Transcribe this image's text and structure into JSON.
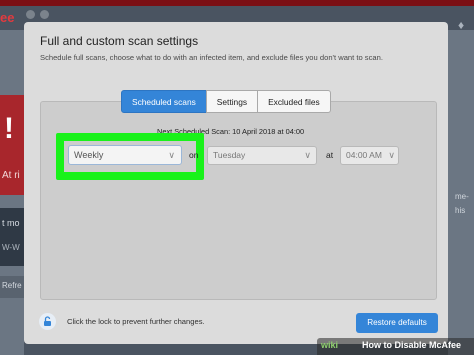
{
  "background_app": {
    "logo": "ee",
    "alert_text": "At ri",
    "side_text_1": "t mo",
    "side_text_2": "W-W",
    "side_text_3": "Refre",
    "right_text_1": "me-",
    "right_text_2": "his",
    "bell_icon": "bell-icon",
    "colors": {
      "brand_red": "#7b0f14",
      "alert_red": "#a8262c"
    }
  },
  "dialog": {
    "title": "Full and custom scan settings",
    "subtitle": "Schedule full scans, choose what to do with an infected item, and exclude files you don't want to scan.",
    "tabs": [
      {
        "label": "Scheduled scans",
        "active": true
      },
      {
        "label": "Settings",
        "active": false
      },
      {
        "label": "Excluded files",
        "active": false
      }
    ],
    "next_scan": "Next Scheduled Scan: 10 April 2018 at 04:00",
    "frequency": {
      "value": "Weekly"
    },
    "on_label": "on",
    "day": {
      "value": "Tuesday"
    },
    "at_label": "at",
    "time": {
      "value": "04:00 AM"
    },
    "lock_text": "Click the lock to prevent further changes.",
    "restore_button": "Restore defaults",
    "colors": {
      "accent": "#3485d8",
      "highlight": "#19f21a"
    }
  },
  "watermark": {
    "brand": "wiki",
    "text": "How to Disable McAfee"
  }
}
